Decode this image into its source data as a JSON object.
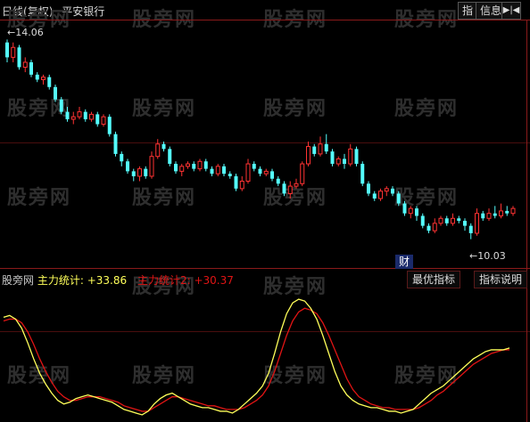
{
  "header": {
    "period": "日线",
    "adjust": "(复权)",
    "stock_name": "平安银行",
    "btn_indicator": "指",
    "btn_info": "信息",
    "btn_nav": "▶|◀"
  },
  "watermark": "股旁网",
  "price_labels": {
    "high": "14.06",
    "low": "10.03"
  },
  "badge": "财",
  "indicator": {
    "source": "股旁网",
    "line1_label": "主力统计:",
    "line1_value": "+33.86",
    "line2_label": "主力统计2:",
    "line2_value": "+30.37",
    "btn_best": "最优指标",
    "btn_desc": "指标说明"
  },
  "colors": {
    "up": "#ff3232",
    "down": "#54fcfc",
    "line1": "#ffff5a",
    "line2": "#e01414",
    "grid": "#8a1a1a"
  },
  "chart_data": {
    "type": "candlestick",
    "y_range": [
      9.7,
      14.3
    ],
    "candles": [
      [
        14.0,
        13.7,
        14.06,
        13.6
      ],
      [
        13.7,
        13.9,
        14.0,
        13.6
      ],
      [
        13.9,
        13.5,
        13.95,
        13.45
      ],
      [
        13.5,
        13.6,
        13.7,
        13.4
      ],
      [
        13.6,
        13.35,
        13.65,
        13.3
      ],
      [
        13.35,
        13.25,
        13.4,
        13.2
      ],
      [
        13.25,
        13.3,
        13.35,
        13.15
      ],
      [
        13.3,
        13.1,
        13.35,
        13.05
      ],
      [
        13.1,
        12.85,
        13.15,
        12.8
      ],
      [
        12.85,
        12.6,
        12.9,
        12.55
      ],
      [
        12.6,
        12.45,
        12.7,
        12.4
      ],
      [
        12.45,
        12.5,
        12.6,
        12.35
      ],
      [
        12.5,
        12.6,
        12.7,
        12.45
      ],
      [
        12.6,
        12.45,
        12.65,
        12.4
      ],
      [
        12.45,
        12.55,
        12.6,
        12.4
      ],
      [
        12.55,
        12.35,
        12.6,
        12.3
      ],
      [
        12.35,
        12.5,
        12.55,
        12.3
      ],
      [
        12.5,
        12.15,
        12.55,
        12.1
      ],
      [
        12.15,
        11.75,
        12.2,
        11.7
      ],
      [
        11.75,
        11.6,
        11.8,
        11.5
      ],
      [
        11.6,
        11.4,
        11.65,
        11.35
      ],
      [
        11.4,
        11.3,
        11.45,
        11.2
      ],
      [
        11.3,
        11.45,
        11.5,
        11.2
      ],
      [
        11.45,
        11.3,
        11.5,
        11.25
      ],
      [
        11.3,
        11.7,
        11.8,
        11.25
      ],
      [
        11.7,
        11.95,
        12.05,
        11.65
      ],
      [
        11.95,
        11.85,
        12.0,
        11.8
      ],
      [
        11.85,
        11.55,
        11.9,
        11.5
      ],
      [
        11.55,
        11.4,
        11.6,
        11.35
      ],
      [
        11.4,
        11.5,
        11.55,
        11.3
      ],
      [
        11.5,
        11.55,
        11.6,
        11.45
      ],
      [
        11.55,
        11.45,
        11.6,
        11.4
      ],
      [
        11.45,
        11.6,
        11.65,
        11.4
      ],
      [
        11.6,
        11.45,
        11.65,
        11.4
      ],
      [
        11.45,
        11.35,
        11.5,
        11.3
      ],
      [
        11.35,
        11.5,
        11.55,
        11.3
      ],
      [
        11.5,
        11.35,
        11.55,
        11.3
      ],
      [
        11.35,
        11.3,
        11.4,
        11.25
      ],
      [
        11.3,
        11.05,
        11.35,
        11.0
      ],
      [
        11.05,
        11.2,
        11.3,
        11.0
      ],
      [
        11.2,
        11.55,
        11.65,
        11.15
      ],
      [
        11.55,
        11.45,
        11.6,
        11.4
      ],
      [
        11.45,
        11.35,
        11.5,
        11.3
      ],
      [
        11.35,
        11.4,
        11.45,
        11.3
      ],
      [
        11.4,
        11.25,
        11.45,
        11.2
      ],
      [
        11.25,
        11.15,
        11.3,
        11.1
      ],
      [
        11.15,
        10.95,
        11.2,
        10.9
      ],
      [
        10.95,
        11.1,
        11.2,
        10.85
      ],
      [
        11.1,
        11.15,
        11.25,
        11.05
      ],
      [
        11.15,
        11.55,
        11.6,
        11.1
      ],
      [
        11.55,
        11.9,
        12.0,
        11.5
      ],
      [
        11.9,
        11.75,
        11.95,
        11.7
      ],
      [
        11.75,
        11.95,
        12.1,
        11.7
      ],
      [
        11.95,
        11.8,
        12.15,
        11.75
      ],
      [
        11.8,
        11.55,
        11.85,
        11.5
      ],
      [
        11.55,
        11.65,
        11.7,
        11.5
      ],
      [
        11.65,
        11.55,
        11.75,
        11.45
      ],
      [
        11.55,
        11.85,
        11.95,
        11.5
      ],
      [
        11.85,
        11.55,
        11.9,
        11.5
      ],
      [
        11.55,
        11.15,
        11.6,
        11.1
      ],
      [
        11.15,
        10.95,
        11.2,
        10.9
      ],
      [
        10.95,
        10.85,
        11.0,
        10.8
      ],
      [
        10.85,
        11.0,
        11.05,
        10.8
      ],
      [
        11.0,
        11.05,
        11.1,
        10.9
      ],
      [
        11.05,
        10.95,
        11.1,
        10.9
      ],
      [
        10.95,
        10.75,
        11.0,
        10.7
      ],
      [
        10.75,
        10.55,
        10.8,
        10.5
      ],
      [
        10.55,
        10.65,
        10.7,
        10.45
      ],
      [
        10.65,
        10.5,
        10.7,
        10.4
      ],
      [
        10.5,
        10.3,
        10.55,
        10.25
      ],
      [
        10.3,
        10.2,
        10.35,
        10.15
      ],
      [
        10.2,
        10.35,
        10.45,
        10.15
      ],
      [
        10.35,
        10.45,
        10.5,
        10.3
      ],
      [
        10.45,
        10.35,
        10.5,
        10.3
      ],
      [
        10.35,
        10.45,
        10.55,
        10.3
      ],
      [
        10.45,
        10.4,
        10.5,
        10.35
      ],
      [
        10.4,
        10.3,
        10.45,
        10.2
      ],
      [
        10.3,
        10.15,
        10.35,
        10.03
      ],
      [
        10.15,
        10.55,
        10.65,
        10.1
      ],
      [
        10.55,
        10.45,
        10.6,
        10.4
      ],
      [
        10.45,
        10.55,
        10.65,
        10.4
      ],
      [
        10.55,
        10.5,
        10.7,
        10.45
      ],
      [
        10.5,
        10.6,
        10.75,
        10.45
      ],
      [
        10.6,
        10.55,
        10.7,
        10.5
      ],
      [
        10.55,
        10.65,
        10.7,
        10.5
      ]
    ],
    "line1_values": [
      28,
      29,
      27,
      22,
      14,
      5,
      -3,
      -9,
      -14,
      -18,
      -20,
      -19,
      -17,
      -16,
      -15,
      -16,
      -17,
      -18,
      -19,
      -21,
      -23,
      -24,
      -25,
      -26,
      -24,
      -20,
      -17,
      -15,
      -14,
      -16,
      -18,
      -20,
      -21,
      -22,
      -22,
      -23,
      -24,
      -24,
      -25,
      -23,
      -20,
      -17,
      -14,
      -10,
      -3,
      8,
      20,
      30,
      36,
      38,
      37,
      33,
      27,
      18,
      8,
      -2,
      -10,
      -15,
      -18,
      -20,
      -21,
      -22,
      -22,
      -23,
      -24,
      -24,
      -25,
      -24,
      -23,
      -20,
      -17,
      -14,
      -12,
      -10,
      -7,
      -4,
      -1,
      2,
      5,
      7,
      9,
      10,
      10,
      10,
      11
    ],
    "line2_values": [
      26,
      27,
      27,
      25,
      20,
      13,
      5,
      -2,
      -8,
      -13,
      -16,
      -18,
      -18,
      -17,
      -16,
      -16,
      -16,
      -17,
      -18,
      -19,
      -21,
      -22,
      -23,
      -24,
      -24,
      -22,
      -20,
      -18,
      -16,
      -16,
      -17,
      -18,
      -19,
      -20,
      -21,
      -21,
      -22,
      -23,
      -23,
      -23,
      -22,
      -20,
      -18,
      -15,
      -10,
      -2,
      8,
      18,
      26,
      31,
      33,
      32,
      30,
      25,
      18,
      10,
      2,
      -6,
      -12,
      -16,
      -18,
      -20,
      -21,
      -22,
      -22,
      -23,
      -23,
      -23,
      -23,
      -22,
      -20,
      -18,
      -15,
      -13,
      -10,
      -7,
      -4,
      -1,
      2,
      4,
      6,
      8,
      9,
      10,
      10
    ],
    "indicator_range": [
      -27,
      42
    ]
  }
}
